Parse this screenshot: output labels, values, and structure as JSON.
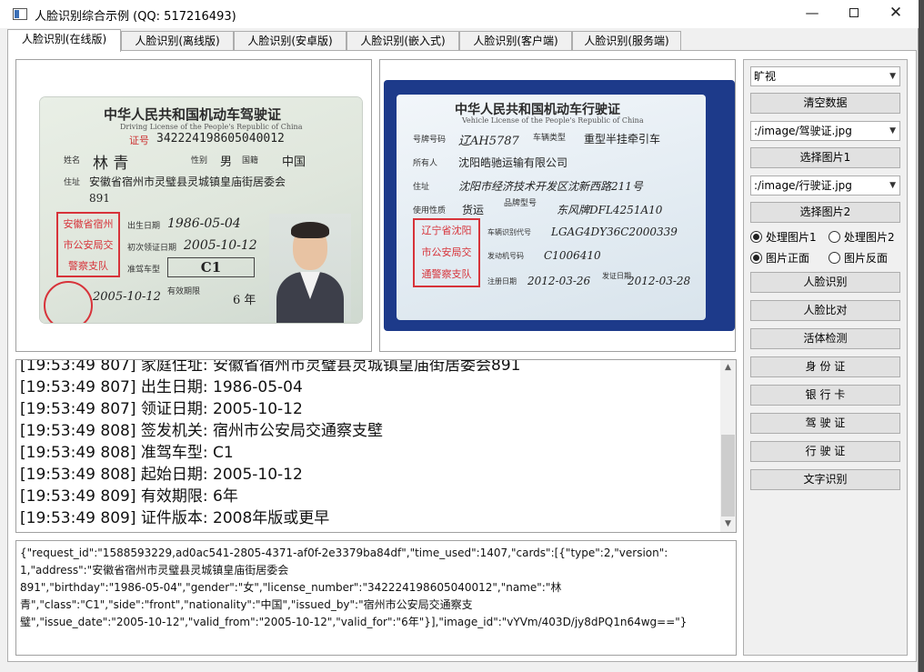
{
  "window": {
    "title": "人脸识别综合示例 (QQ: 517216493)",
    "minimize_glyph": "—",
    "close_glyph": "✕"
  },
  "tabs": [
    {
      "label": "人脸识别(在线版)",
      "active": true
    },
    {
      "label": "人脸识别(离线版)",
      "active": false
    },
    {
      "label": "人脸识别(安卓版)",
      "active": false
    },
    {
      "label": "人脸识别(嵌入式)",
      "active": false
    },
    {
      "label": "人脸识别(客户端)",
      "active": false
    },
    {
      "label": "人脸识别(服务端)",
      "active": false
    }
  ],
  "image1": {
    "title": "中华人民共和国机动车驾驶证",
    "subtitle": "Driving License of the People's Republic of China",
    "number_label": "证号",
    "number": "342224198605040012",
    "name_label": "姓名",
    "name": "林 青",
    "sex_label": "性别",
    "sex": "男",
    "nationality_label": "国籍",
    "nationality": "中国",
    "address_label": "住址",
    "address": "安徽省宿州市灵璧县灵城镇皇庙街居委会",
    "address2": "891",
    "birth_label": "出生日期",
    "birth": "1986-05-04",
    "issue_label": "初次领证日期",
    "issue": "2005-10-12",
    "class_label": "准驾车型",
    "class": "C1",
    "valid_label": "有效期限",
    "valid_from": "2005-10-12",
    "valid_for": "6 年",
    "stamp_lines": [
      "安徽省宿州",
      "市公安局交",
      "警察支队"
    ]
  },
  "image2": {
    "title": "中华人民共和国机动车行驶证",
    "subtitle": "Vehicle License of the People's Republic of China",
    "plate_label": "号牌号码",
    "plate": "辽AH5787",
    "type_label": "车辆类型",
    "type": "重型半挂牵引车",
    "owner_label": "所有人",
    "owner": "沈阳皓驰运输有限公司",
    "address_label": "住址",
    "address": "沈阳市经济技术开发区沈新西路211号",
    "use_label": "使用性质",
    "use": "货运",
    "model_label": "品牌型号",
    "model": "东风牌DFL4251A10",
    "vin_label": "车辆识别代号",
    "vin": "LGAG4DY36C2000339",
    "engine_label": "发动机号码",
    "engine": "C1006410",
    "reg_label": "注册日期",
    "reg": "2012-03-26",
    "issue_label": "发证日期",
    "issue": "2012-03-28",
    "stamp_lines": [
      "辽宁省沈阳",
      "市公安局交",
      "通警察支队"
    ]
  },
  "log": {
    "lines": [
      "[19:53:49 807] 家庭住址: 安徽省宿州市灵璧县灵城镇皇庙街居委会891",
      "[19:53:49 807] 出生日期: 1986-05-04",
      "[19:53:49 807] 领证日期: 2005-10-12",
      "[19:53:49 808] 签发机关: 宿州市公安局交通察支壁",
      "[19:53:49 808] 准驾车型: C1",
      "[19:53:49 808] 起始日期: 2005-10-12",
      "[19:53:49 809] 有效期限: 6年",
      "[19:53:49 809] 证件版本: 2008年版或更早"
    ]
  },
  "json_output": {
    "lines": [
      "{\"request_id\":\"1588593229,ad0ac541-2805-4371-af0f-2e3379ba84df\",\"time_used\":1407,\"cards\":[{\"type\":2,\"version\":",
      "1,\"address\":\"安徽省宿州市灵璧县灵城镇皇庙街居委会",
      "891\",\"birthday\":\"1986-05-04\",\"gender\":\"女\",\"license_number\":\"342224198605040012\",\"name\":\"林",
      "青\",\"class\":\"C1\",\"side\":\"front\",\"nationality\":\"中国\",\"issued_by\":\"宿州市公安局交通察支",
      "璧\",\"issue_date\":\"2005-10-12\",\"valid_from\":\"2005-10-12\",\"valid_for\":\"6年\"}],\"image_id\":\"vYVm/403D/jy8dPQ1n64wg==\"}"
    ]
  },
  "sidebar": {
    "mode_select": "旷视",
    "clear_button": "清空数据",
    "image1_path": ":/image/驾驶证.jpg",
    "select_image1_button": "选择图片1",
    "image2_path": ":/image/行驶证.jpg",
    "select_image2_button": "选择图片2",
    "radio_process1": "处理图片1",
    "radio_process2": "处理图片2",
    "radio_front": "图片正面",
    "radio_back": "图片反面",
    "buttons": [
      "人脸识别",
      "人脸比对",
      "活体检测",
      "身 份 证",
      "银 行 卡",
      "驾 驶 证",
      "行 驶 证",
      "文字识别"
    ]
  }
}
